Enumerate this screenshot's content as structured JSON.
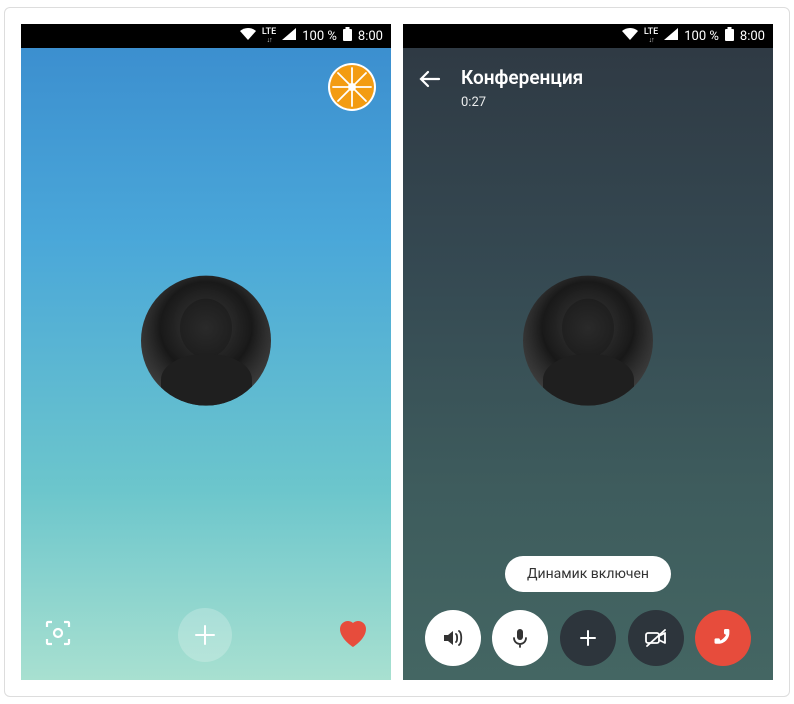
{
  "status_bar": {
    "lte": "LTE",
    "battery_pct": "100 %",
    "time": "8:00"
  },
  "phone1": {
    "icons": {
      "capture": "capture-icon",
      "add": "+",
      "heart": "heart-icon",
      "orange": "orange-fruit-icon"
    }
  },
  "phone2": {
    "header": {
      "title": "Конференция",
      "timer": "0:27"
    },
    "toast": "Динамик включен",
    "controls": {
      "speaker": "speaker-icon",
      "mic": "microphone-icon",
      "add": "+",
      "video_off": "video-off-icon",
      "hangup": "phone-hangup-icon"
    }
  }
}
